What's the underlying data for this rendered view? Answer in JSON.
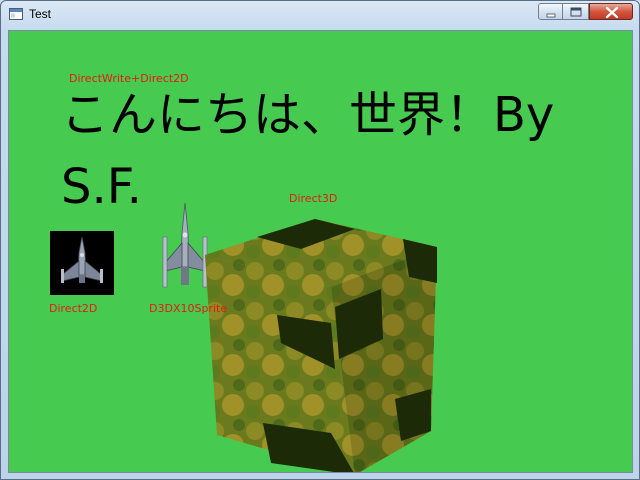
{
  "window": {
    "title": "Test",
    "app_icon": "window-app-icon",
    "controls": [
      "minimize-icon",
      "maximize-icon",
      "close-icon"
    ]
  },
  "labels": {
    "directwrite": "DirectWrite+Direct2D",
    "direct3d": "Direct3D",
    "direct2d": "Direct2D",
    "d3dx10sprite": "D3DX10Sprite"
  },
  "headline": {
    "line1": "こんにちは、世界！By",
    "line2": "S.F."
  },
  "colors": {
    "client_background": "#46cb50",
    "label_text": "#e81b0d",
    "headline_text": "#000000"
  }
}
